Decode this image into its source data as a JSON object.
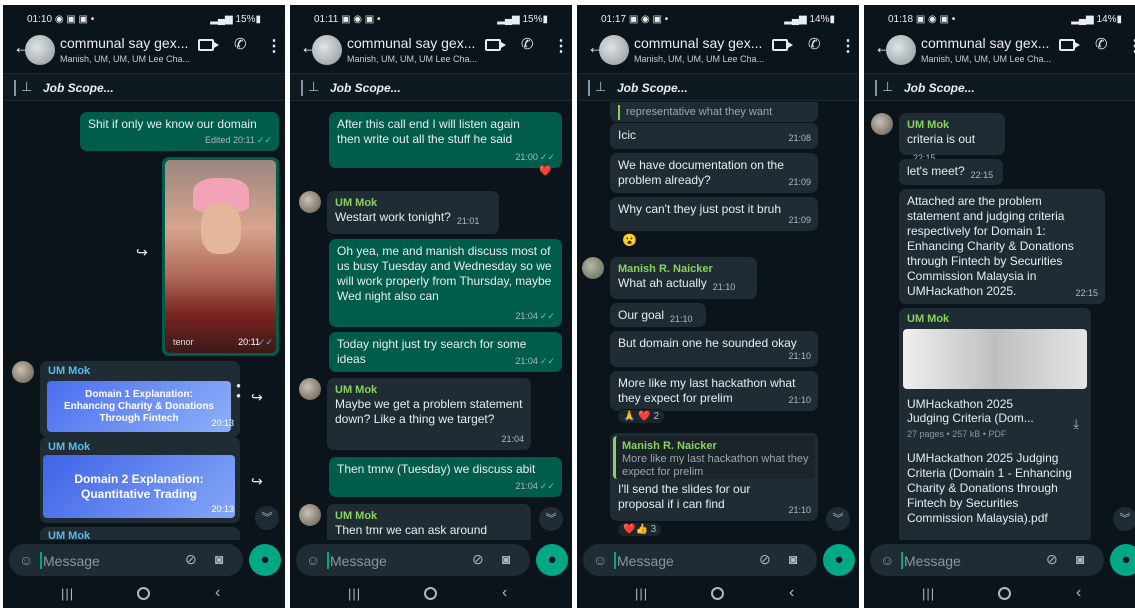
{
  "chat": {
    "title": "communal say gex...",
    "subtitle": "Manish, UM, UM, UM Lee Cha...",
    "pinned": "Job Scope..."
  },
  "input": {
    "placeholder": "Message"
  },
  "screens": [
    {
      "status_time": "01:10",
      "status_icons_left": "◉ ▣ ▣ •",
      "battery": "15%",
      "messages": {
        "m1_text": "Shit if only we know our domain",
        "m1_time": "Edited 20:11",
        "gif_tag": "tenor",
        "gif_time": "20:11",
        "sender1": "UM Mok",
        "slide1_text": "Domain 1 Explanation: Enhancing Charity & Donations Through Fintech",
        "slide1_time": "20:13",
        "sender2": "UM Mok",
        "slide2_text": "Domain 2 Explanation: Quantitative Trading",
        "slide2_time": "20:13",
        "sender3": "UM Mok"
      }
    },
    {
      "status_time": "01:11",
      "status_icons_left": "▣ ◉ ▣ •",
      "battery": "15%",
      "messages": {
        "m1_text": "After this call end I will listen again then write out all the stuff he said",
        "m1_time": "21:00",
        "m1_react": "❤️",
        "m2_sender": "UM Mok",
        "m2_text": "Westart work tonight?",
        "m2_time": "21:01",
        "m3_text": "Oh yea, me and manish discuss most of us busy Tuesday and Wednesday so we will work properly from Thursday, maybe Wed night also can",
        "m3_time": "21:04",
        "m4_text": "Today night just try search for some ideas",
        "m4_time": "21:04",
        "m5_sender": "UM Mok",
        "m5_text": "Maybe we get a problem statement down? Like a thing we target?",
        "m5_time": "21:04",
        "m6_text": "Then tmrw (Tuesday) we discuss abit",
        "m6_time": "21:04",
        "m7_sender": "UM Mok",
        "m7_text": "Then tmr we can ask around"
      }
    },
    {
      "status_time": "01:17",
      "status_icons_left": "▣ ◉ ▣ •",
      "battery": "14%",
      "messages": {
        "m0_text": "representative what they want",
        "m1_text": "Icic",
        "m1_time": "21:08",
        "m2_text": "We have documentation on the problem already?",
        "m2_time": "21:09",
        "m3_text": "Why can't they just post it bruh",
        "m3_time": "21:09",
        "m3_react": "😮",
        "m4_sender": "Manish R. Naicker",
        "m4_text": "What ah actually",
        "m4_time": "21:10",
        "m5_text": "Our goal",
        "m5_time": "21:10",
        "m6_text": "But domain one he sounded okay",
        "m6_time": "21:10",
        "m7_text": "More like my last hackathon what they expect for prelim",
        "m7_time": "21:10",
        "m7_react": "🙏 ❤️ 2",
        "m8_sender": "Manish R. Naicker",
        "m8_quote": "More like my last hackathon what they expect for prelim",
        "m8_text": "I'll send the slides for our proposal if i can find",
        "m8_time": "21:10",
        "m8_react": "❤️👍 3"
      }
    },
    {
      "status_time": "01:18",
      "status_icons_left": "▣ ◉ ▣ •",
      "battery": "14%",
      "messages": {
        "m1_sender": "UM Mok",
        "m1_text": "criteria is out",
        "m1_time": "22:15",
        "m2_text": "let's meet?",
        "m2_time": "22:15",
        "m3_text": "Attached are the problem statement and judging criteria respectively for Domain 1: Enhancing Charity & Donations through Fintech by Securities Commission Malaysia in UMHackathon 2025.",
        "m3_time": "22:15",
        "m4_sender": "UM Mok",
        "doc_title": "UMHackathon 2025 Judging Criteria (Dom...",
        "doc_meta": "27 pages • 257 kB • PDF",
        "doc_caption": "UMHackathon 2025 Judging Criteria (Domain 1 - Enhancing Charity & Donations through Fintech by Securities Commission Malaysia).pdf"
      }
    }
  ]
}
